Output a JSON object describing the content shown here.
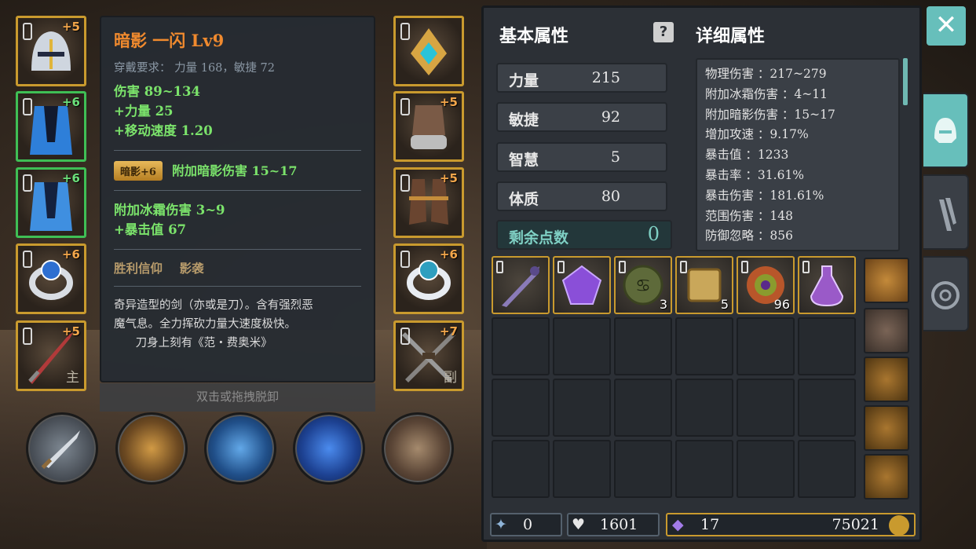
{
  "equipment": {
    "left": [
      {
        "lvl": "+5",
        "green": false
      },
      {
        "lvl": "+6",
        "green": true
      },
      {
        "lvl": "+6",
        "green": true
      },
      {
        "lvl": "+6",
        "green": false
      },
      {
        "lvl": "+5",
        "green": false,
        "hand": "主"
      }
    ],
    "right": [
      {
        "lvl": "",
        "green": false
      },
      {
        "lvl": "+5",
        "green": false
      },
      {
        "lvl": "+5",
        "green": false
      },
      {
        "lvl": "+6",
        "green": false
      },
      {
        "lvl": "+7",
        "green": false,
        "hand": "副"
      }
    ]
  },
  "tooltip": {
    "title": "暗影 一闪 Lv9",
    "requirement": "穿戴要求：  力量 168，敏捷 72",
    "stats": [
      "伤害   89~134",
      "+力量 25",
      "+移动速度 1.20"
    ],
    "set_badge": "暗影+6",
    "set_bonus": "附加暗影伤害 15~17",
    "extra": [
      "附加冰霜伤害 3~9",
      "+暴击值 67"
    ],
    "faith": "胜利信仰    影袭",
    "desc": [
      "奇异造型的剑（亦或是刀）。含有强烈恶",
      "魔气息。全力挥砍力量大速度极快。",
      "      刀身上刻有《范・费奥米》"
    ]
  },
  "hint": "双击或拖拽脱卸",
  "panel": {
    "basic_title": "基本属性",
    "detail_title": "详细属性",
    "help": "?",
    "attrs": [
      {
        "name": "力量",
        "value": "215"
      },
      {
        "name": "敏捷",
        "value": "92"
      },
      {
        "name": "智慧",
        "value": "5"
      },
      {
        "name": "体质",
        "value": "80"
      }
    ],
    "remaining": {
      "name": "剩余点数",
      "value": "0"
    },
    "details": [
      "物理伤害 ：217~279",
      "附加冰霜伤害 ：4~11",
      "附加暗影伤害 ：15~17",
      "增加攻速 ：9.17%",
      "暴击值 ：1233",
      "暴击率 ：31.61%",
      "暴击伤害 ：181.61%",
      "范围伤害 ：148",
      "防御忽略 ：856"
    ],
    "items": [
      {
        "name": "staff",
        "count": ""
      },
      {
        "name": "purple-gem",
        "count": ""
      },
      {
        "name": "rune-stone",
        "count": "3"
      },
      {
        "name": "scroll",
        "count": "5"
      },
      {
        "name": "vortex-orb",
        "count": "96"
      },
      {
        "name": "potion",
        "count": ""
      }
    ],
    "currency": {
      "keys": "0",
      "souls": "1601",
      "crystals": "17",
      "gold": "75021"
    }
  },
  "colors": {
    "accent": "#67bfbb",
    "gold_border": "#c99a2e",
    "green_border": "#3fbf55",
    "title": "#f08a2e",
    "stat": "#7be36b"
  }
}
